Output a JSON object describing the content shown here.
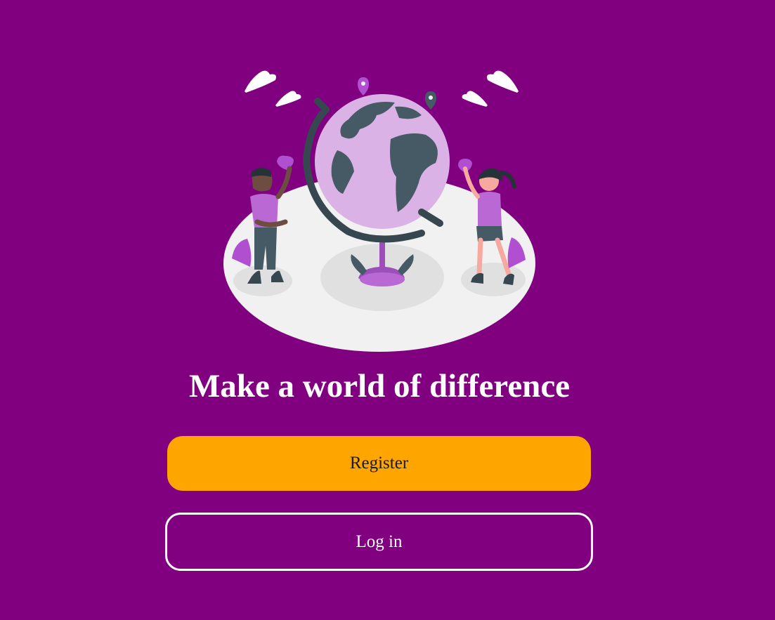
{
  "colors": {
    "background": "#800080",
    "register_button": "#ffa500",
    "login_border": "#ffffff",
    "globe_ocean": "#dbb2e5",
    "landmass": "#455a64",
    "accent_purple": "#b04fcf"
  },
  "hero": {
    "illustration": "kids-around-globe-illustration",
    "headline": "Make a world of difference"
  },
  "actions": {
    "register_label": "Register",
    "login_label": "Log in"
  }
}
